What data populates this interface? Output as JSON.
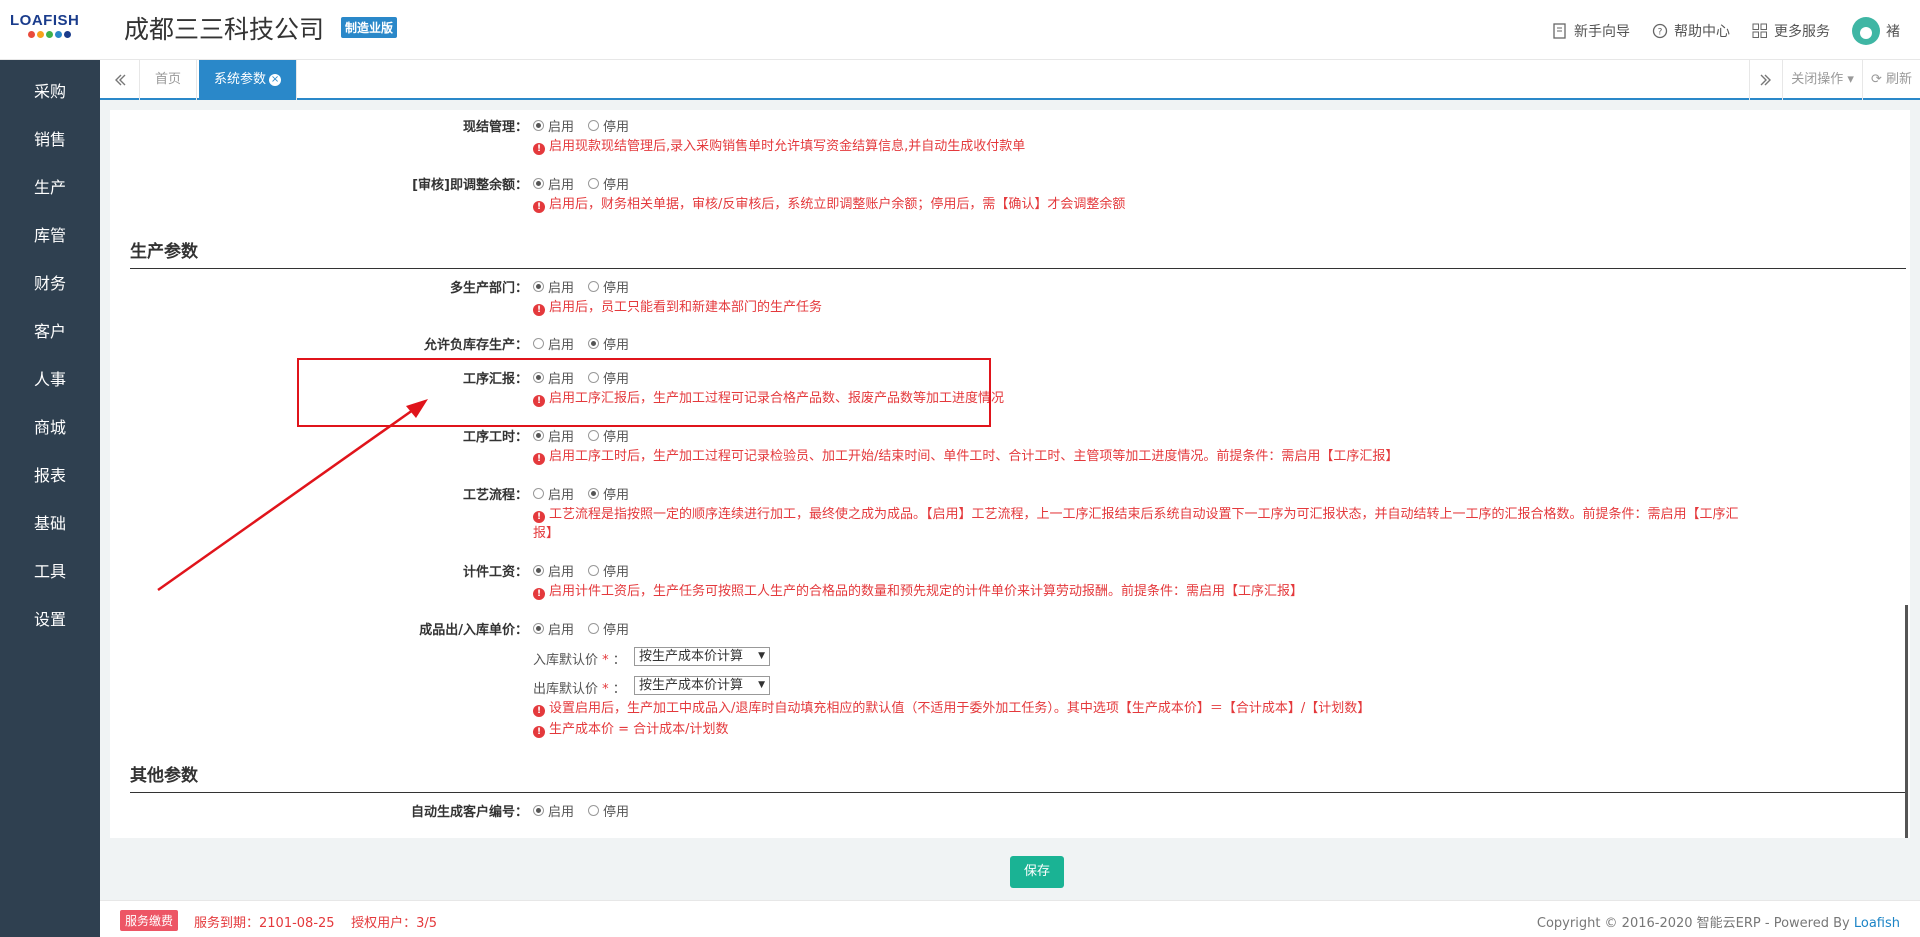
{
  "header": {
    "logo_text": "LOAFISH",
    "logo_dot_colors": [
      "#e94b3c",
      "#f7a21c",
      "#3db24b",
      "#2a88c9",
      "#1a3c8c"
    ],
    "company": "成都三三科技公司",
    "edition": "制造业版",
    "links": [
      {
        "label": "新手向导",
        "icon": "guide-icon"
      },
      {
        "label": "帮助中心",
        "icon": "help-icon"
      },
      {
        "label": "更多服务",
        "icon": "apps-icon"
      }
    ],
    "user": "褚"
  },
  "sidebar": {
    "items": [
      "采购",
      "销售",
      "生产",
      "库管",
      "财务",
      "客户",
      "人事",
      "商城",
      "报表",
      "基础",
      "工具",
      "设置"
    ]
  },
  "tabs": {
    "home": "首页",
    "active": "系统参数",
    "close_ops": "关闭操作",
    "refresh": "刷新"
  },
  "settings": {
    "on": "启用",
    "off": "停用",
    "cash_mgmt": {
      "label": "现结管理：",
      "note": "启用现款现结管理后,录入采购销售单时允许填写资金结算信息,并自动生成收付款单"
    },
    "audit_adjust": {
      "label": "[审核]即调整余额：",
      "note": "启用后，财务相关单据，审核/反审核后，系统立即调整账户余额；停用后，需【确认】才会调整余额"
    },
    "production_section": "生产参数",
    "multi_dept": {
      "label": "多生产部门：",
      "note": "启用后，员工只能看到和新建本部门的生产任务"
    },
    "negative_stock": {
      "label": "允许负库存生产："
    },
    "process_report": {
      "label": "工序汇报：",
      "note": "启用工序汇报后，生产加工过程可记录合格产品数、报废产品数等加工进度情况"
    },
    "process_hours": {
      "label": "工序工时：",
      "note": "启用工序工时后，生产加工过程可记录检验员、加工开始/结束时间、单件工时、合计工时、主管项等加工进度情况。前提条件：需启用【工序汇报】"
    },
    "craft_flow": {
      "label": "工艺流程：",
      "note_line1": "工艺流程是指按照一定的顺序连续进行加工，最终使之成为成品。【启用】工艺流程，上一工序汇报结束后系统自动设置下一工序为可汇报状态，并自动结转上一工序的汇报合格数。前提条件：需启用【工序汇",
      "note_line2": "报】"
    },
    "piece_wage": {
      "label": "计件工资：",
      "note": "启用计件工资后，生产任务可按照工人生产的合格品的数量和预先规定的计件单价来计算劳动报酬。前提条件：需启用【工序汇报】"
    },
    "unit_price": {
      "label": "成品出/入库单价：",
      "in_label": "入库默认价",
      "out_label": "出库默认价",
      "in_value": "按生产成本价计算",
      "out_value": "按生产成本价计算",
      "note1": "设置启用后，生产加工中成品入/退库时自动填充相应的默认值（不适用于委外加工任务）。其中选项【生产成本价】＝【合计成本】/【计划数】",
      "note2": "生产成本价 = 合计成本/计划数"
    },
    "other_section": "其他参数",
    "auto_customer_no": {
      "label": "自动生成客户编号："
    }
  },
  "save": "保存",
  "footer": {
    "fee": "服务缴费",
    "expiry": "服务到期：2101-08-25    授权用户：3/5",
    "copyright": "Copyright © 2016-2020 智能云ERP - Powered By ",
    "brand": "Loafish"
  }
}
